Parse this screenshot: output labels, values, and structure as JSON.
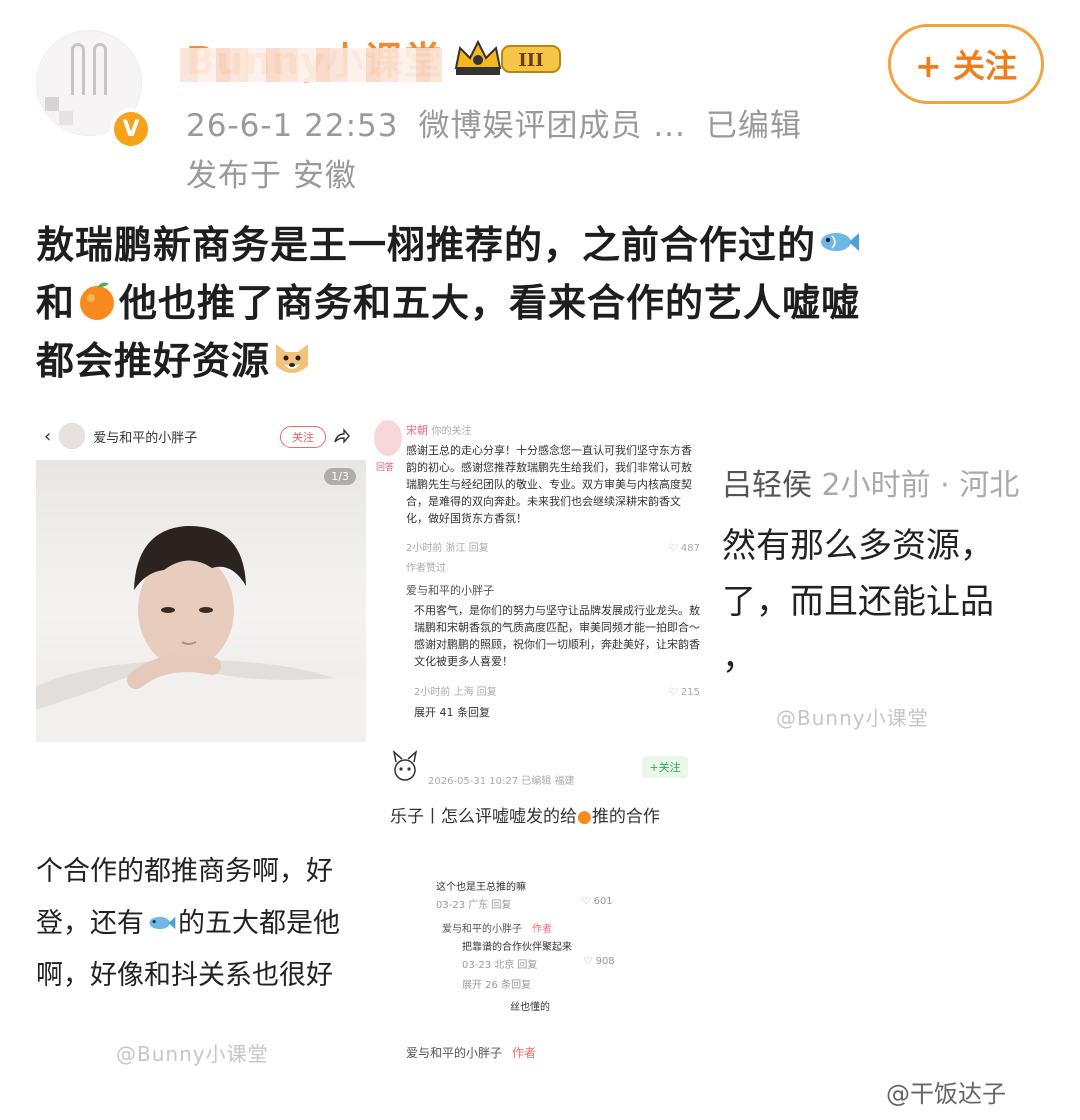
{
  "post": {
    "username": "Bunny小课堂",
    "level_badge": "III",
    "timestamp": "26-6-1 22:53",
    "source": "微博娱评团成员 ...",
    "edited": "已编辑",
    "location": "发布于 安徽",
    "follow_label": "+ 关注",
    "text_lines": [
      "敖瑞鹏新商务是王一栩推荐的，之前合作过的",
      "和",
      "他也推了商务和五大，看来合作的艺人嘘嘘",
      "都会推好资源"
    ]
  },
  "shot1": {
    "username": "爱与和平的小胖子",
    "follow": "关注",
    "counter": "1/3"
  },
  "shot2": {
    "name": "宋朝",
    "tag": "你的关注",
    "badge": "回答",
    "p1": "感谢王总的走心分享！十分感念您一直认可我们坚守东方香韵的初心。感谢您推荐敖瑞鹏先生给我们，我们非常认可敖瑞鹏先生与经纪团队的敬业、专业。双方审美与内核高度契合，是难得的双向奔赴。未来我们也会继续深耕宋韵香文化，做好国货东方香氛！",
    "meta1": "2小时前 浙江  回复",
    "likes1": "487",
    "author_tag": "作者赞过",
    "reply_user": "爱与和平的小胖子",
    "p2": "不用客气，是你们的努力与坚守让品牌发展成行业龙头。敖瑞鹏和宋朝香氛的气质高度匹配，审美同频才能一拍即合～感谢对鹏鹏的照顾，祝你们一切顺利，奔赴美好，让宋韵香文化被更多人喜爱！",
    "meta2": "2小时前 上海  回复",
    "likes2": "215",
    "expand": "展开 41 条回复"
  },
  "shot3": {
    "name": "吕轻侯",
    "time": "2小时前 · 河北",
    "l1": "然有那么多资源，",
    "l2": "了，而且还能让品",
    "l3": "，",
    "watermark": "@Bunny小课堂"
  },
  "shot4": {
    "l1": "个合作的都推商务啊，好",
    "l2a": "登，还有",
    "l2b": "的五大都是他",
    "l3": "啊，好像和抖关系也很好",
    "watermark": "@Bunny小课堂"
  },
  "shot5": {
    "date": "2026-05-31 10:27  已编辑  福建",
    "follow": "+关注",
    "title_a": "乐子丨怎么评嘘嘘发的给",
    "title_b": "推的合作",
    "c1": "这个也是王总推的嘛",
    "m1": "03-23 广东  回复",
    "likes1": "601",
    "reply_user": "爱与和平的小胖子",
    "author": "作者",
    "c2": "把靠谱的合作伙伴聚起来",
    "m2": "03-23 北京  回复",
    "likes2": "908",
    "expand": "展开 26 条回复",
    "fans": "丝也懂的",
    "bottom_user": "爱与和平的小胖子",
    "bottom_author": "作者"
  },
  "watermark_main": "@干饭达子",
  "colors": {
    "accent_orange": "#f08a2b",
    "follow_border": "#f3a33b",
    "weibo_badge": "#f7a21b"
  }
}
